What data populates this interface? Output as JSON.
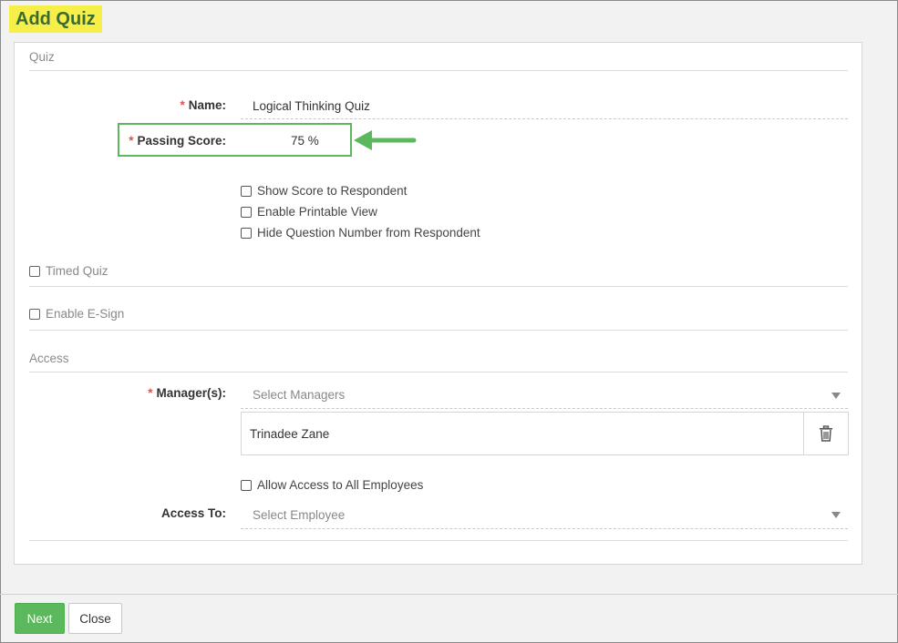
{
  "page": {
    "title": "Add Quiz"
  },
  "quiz_section": {
    "heading": "Quiz",
    "name": {
      "required_mark": "*",
      "label": "Name:",
      "value": "Logical Thinking Quiz"
    },
    "passing_score": {
      "required_mark": "*",
      "label": "Passing Score:",
      "value": "75 %"
    },
    "options": [
      {
        "label": "Show Score to Respondent",
        "checked": false
      },
      {
        "label": "Enable Printable View",
        "checked": false
      },
      {
        "label": "Hide Question Number from Respondent",
        "checked": false
      }
    ],
    "timed_quiz": {
      "label": "Timed Quiz",
      "checked": false
    },
    "enable_esign": {
      "label": "Enable E-Sign",
      "checked": false
    }
  },
  "access_section": {
    "heading": "Access",
    "managers": {
      "required_mark": "*",
      "label": "Manager(s):",
      "placeholder": "Select Managers",
      "selected": [
        "Trinadee Zane"
      ]
    },
    "allow_all": {
      "label": "Allow Access to All Employees",
      "checked": false
    },
    "access_to": {
      "label": "Access To:",
      "placeholder": "Select Employee"
    }
  },
  "footer": {
    "next_label": "Next",
    "close_label": "Close"
  },
  "colors": {
    "accent_green": "#5cb85c",
    "title_highlight": "#f6ef4a",
    "title_text": "#3a6b35",
    "required_red": "#d9534f"
  }
}
